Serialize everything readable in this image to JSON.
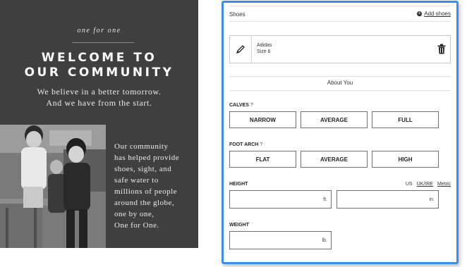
{
  "left": {
    "tagline": "one for one",
    "title_line1": "WELCOME TO",
    "title_line2": "OUR COMMUNITY",
    "intro_line1": "We believe in a better tomorrow.",
    "intro_line2": "And we have from the start.",
    "story_lines": [
      "Our community",
      "has helped provide",
      "shoes, sight, and",
      "safe water to",
      "millions of people",
      "around the globe,",
      "one by one,",
      "One for One."
    ]
  },
  "form": {
    "shoes_title": "Shoes",
    "add_shoes": "Add shoes",
    "shoe": {
      "brand": "Adidas",
      "size": "Size 6"
    },
    "about_title": "About You",
    "calves": {
      "label": "CALVES",
      "help": "?",
      "options": [
        "NARROW",
        "AVERAGE",
        "FULL"
      ]
    },
    "foot_arch": {
      "label": "FOOT ARCH",
      "help": "?",
      "options": [
        "FLAT",
        "AVERAGE",
        "HIGH"
      ]
    },
    "height": {
      "label": "HEIGHT",
      "units": [
        "US",
        "UK/IRE",
        "Metric"
      ],
      "ft_suffix": "ft.",
      "in_suffix": "in.",
      "ft_value": "",
      "in_value": ""
    },
    "weight": {
      "label": "WEIGHT",
      "suffix": "lb.",
      "value": ""
    }
  },
  "colors": {
    "accent_border": "#3d8ee8",
    "panel_bg": "#3f3f3f"
  }
}
